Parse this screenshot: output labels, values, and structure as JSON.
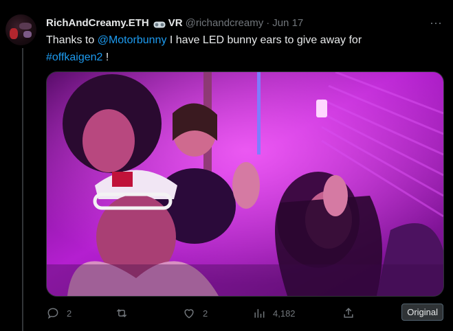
{
  "tweet": {
    "display_name": "RichAndCreamy.ETH",
    "vr_label": "VR",
    "handle": "@richandcreamy",
    "dot": "·",
    "date": "Jun 17",
    "text": {
      "prefix": "Thanks to ",
      "mention": "@Motorbunny",
      "middle": " I have LED bunny ears to give away for",
      "hashtag": "#offkaigen2",
      "suffix": " !"
    }
  },
  "actions": {
    "replies": "2",
    "reposts": "",
    "likes": "2",
    "views": "4,182"
  },
  "badge": "Original",
  "more_glyph": "···",
  "icons": [
    "vr-goggles-icon",
    "more-icon",
    "reply-icon",
    "repost-icon",
    "like-icon",
    "views-icon",
    "share-icon"
  ],
  "colors": {
    "background": "#000000",
    "text": "#e7e9ea",
    "muted": "#71767b",
    "link": "#1d9bf0",
    "photo_tint": "#c022d6"
  }
}
